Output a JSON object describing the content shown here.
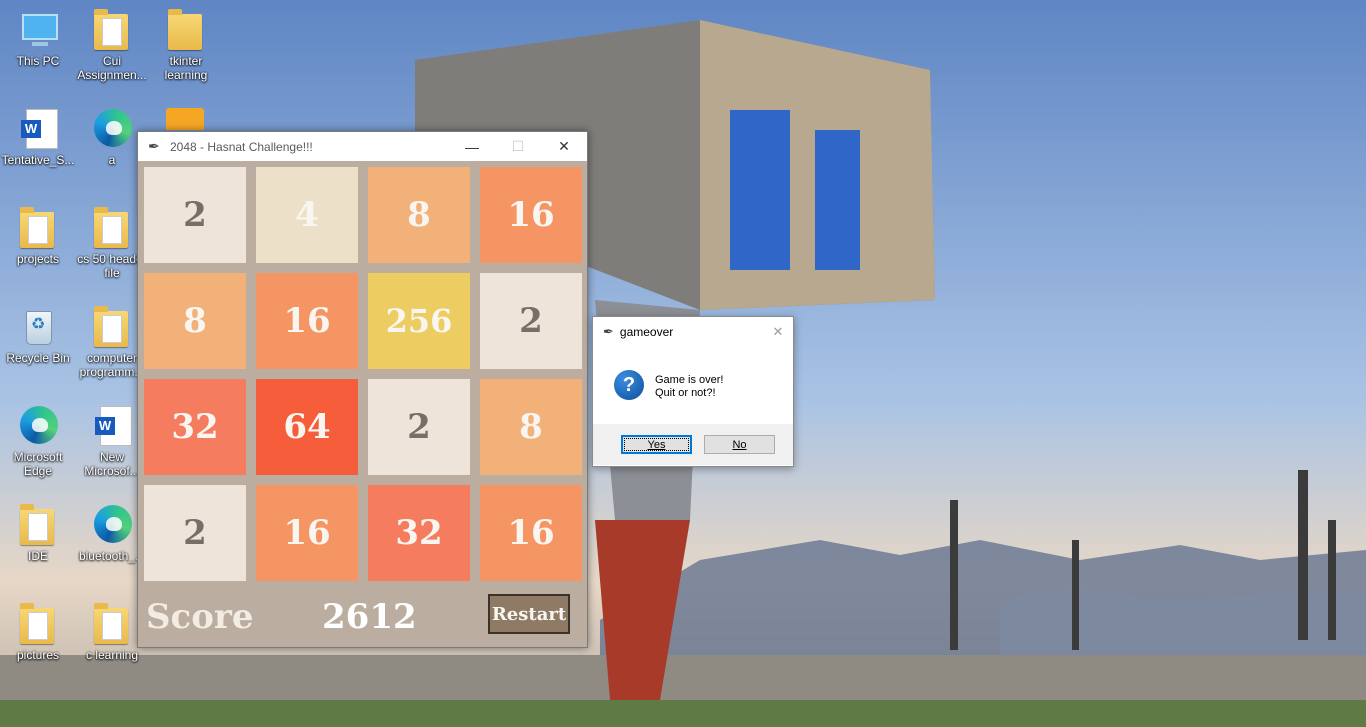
{
  "desktop": {
    "icons": [
      {
        "label": "This PC",
        "icon": "computer-icon"
      },
      {
        "label": "Cui Assignmen...",
        "icon": "folder-icon"
      },
      {
        "label": "tkinter learning",
        "icon": "folder-icon"
      },
      {
        "label": "Tentative_S...",
        "icon": "word-document-icon"
      },
      {
        "label": "a",
        "icon": "edge-shortcut-icon"
      },
      {
        "label": "projects",
        "icon": "folder-icon"
      },
      {
        "label": "cs 50 header file",
        "icon": "folder-icon"
      },
      {
        "label": "Recycle Bin",
        "icon": "recycle-bin-icon"
      },
      {
        "label": "computer programm...",
        "icon": "folder-icon"
      },
      {
        "label": "Microsoft Edge",
        "icon": "edge-icon"
      },
      {
        "label": "New Microsof...",
        "icon": "word-document-icon"
      },
      {
        "label": "IDE",
        "icon": "folder-icon"
      },
      {
        "label": "bluetooth_...",
        "icon": "edge-shortcut-icon"
      },
      {
        "label": "pictures",
        "icon": "folder-icon"
      },
      {
        "label": "c learning",
        "icon": "folder-icon"
      }
    ]
  },
  "game": {
    "title": "2048 - Hasnat Challenge!!!",
    "board": [
      [
        2,
        4,
        8,
        16
      ],
      [
        8,
        16,
        256,
        2
      ],
      [
        32,
        64,
        2,
        8
      ],
      [
        2,
        16,
        32,
        16
      ]
    ],
    "board_text": [
      [
        "2",
        "4",
        "8",
        "16"
      ],
      [
        "8",
        "16",
        "256",
        "2"
      ],
      [
        "32",
        "64",
        "2",
        "8"
      ],
      [
        "2",
        "16",
        "32",
        "16"
      ]
    ],
    "score_label": "Score",
    "score": "2612",
    "restart_label": "Restart"
  },
  "dialog": {
    "title": "gameover",
    "message_line1": "Game is over!",
    "message_line2": "Quit or not?!",
    "icon": "question-icon",
    "yes_label": "Yes",
    "no_label": "No"
  },
  "colors": {
    "board_bg": "#bbada0",
    "tile_2": "#eee4da",
    "tile_4": "#ede0c8",
    "tile_8": "#f2b179",
    "tile_16": "#f59563",
    "tile_32": "#f67c5f",
    "tile_64": "#f65e3b",
    "tile_256": "#edcc61",
    "restart_button": "#8f7a66",
    "dialog_primary_border": "#0078d7"
  }
}
